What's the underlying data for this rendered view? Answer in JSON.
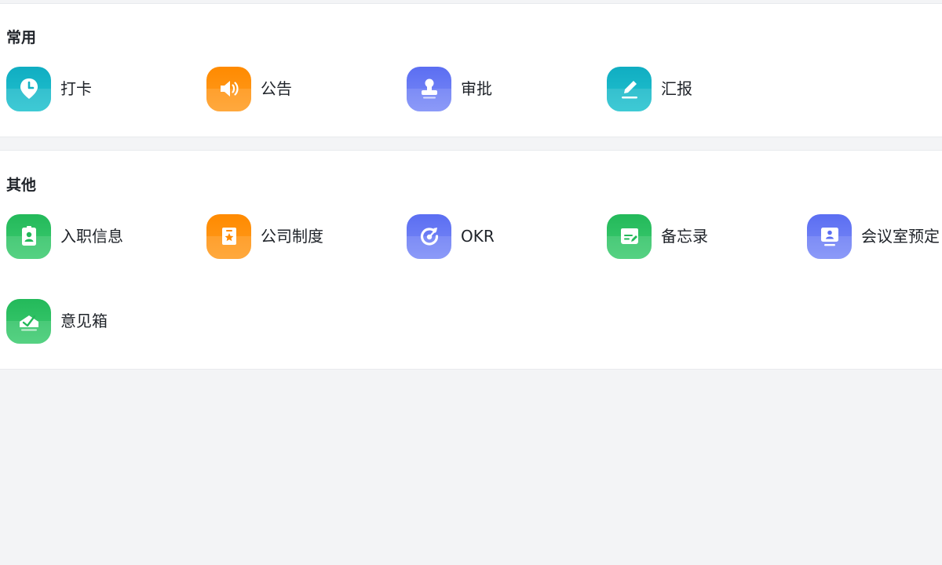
{
  "sections": [
    {
      "title": "常用",
      "apps": [
        {
          "label": "打卡",
          "icon": "clock-pin-icon",
          "color": "#10adc2"
        },
        {
          "label": "公告",
          "icon": "speaker-icon",
          "color": "#ff8a00"
        },
        {
          "label": "审批",
          "icon": "stamp-icon",
          "color": "#5b6ef2"
        },
        {
          "label": "汇报",
          "icon": "pencil-icon",
          "color": "#10adc2"
        }
      ]
    },
    {
      "title": "其他",
      "apps": [
        {
          "label": "入职信息",
          "icon": "badge-icon",
          "color": "#23b95a"
        },
        {
          "label": "公司制度",
          "icon": "rules-star-icon",
          "color": "#ff8a00"
        },
        {
          "label": "OKR",
          "icon": "target-icon",
          "color": "#5b6ef2"
        },
        {
          "label": "备忘录",
          "icon": "memo-icon",
          "color": "#23b95a"
        },
        {
          "label": "会议室预定",
          "icon": "meeting-room-icon",
          "color": "#5b6ef2"
        },
        {
          "label": "意见箱",
          "icon": "envelope-icon",
          "color": "#23b95a"
        }
      ]
    }
  ]
}
